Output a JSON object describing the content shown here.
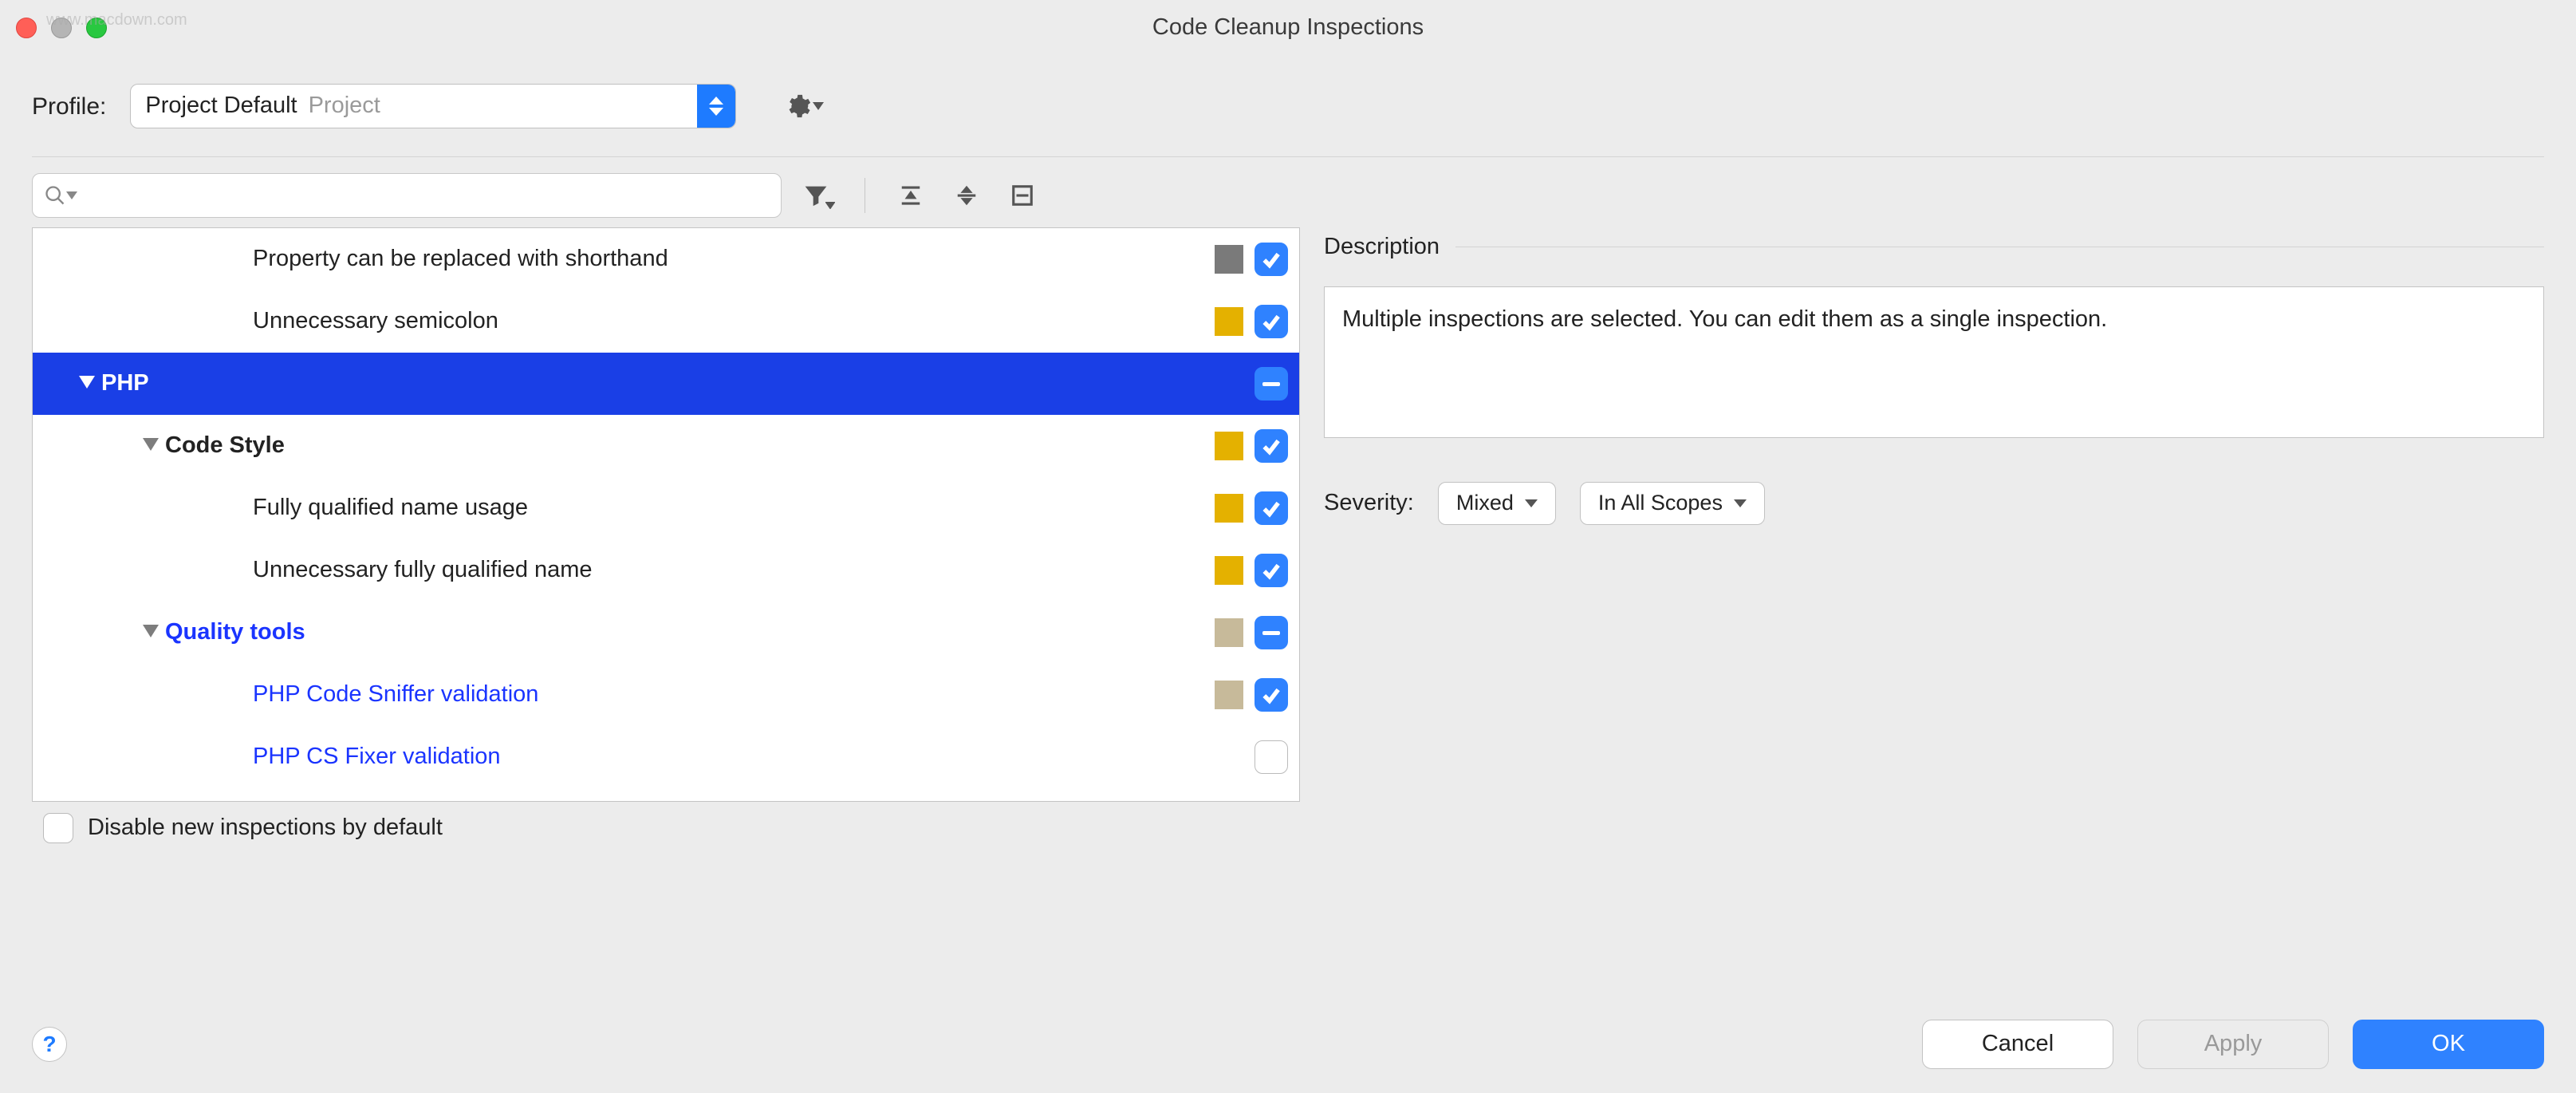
{
  "title": "Code Cleanup Inspections",
  "watermark": "www.macdown.com",
  "profile": {
    "label": "Profile:",
    "value": "Project Default",
    "hint": "Project"
  },
  "search": {
    "placeholder": ""
  },
  "tree": {
    "items": [
      {
        "label": "Property can be replaced with shorthand",
        "indent": 230,
        "bold": false,
        "blue": false,
        "arrow": false,
        "swatch": "gray",
        "check": "on",
        "selected": false
      },
      {
        "label": "Unnecessary semicolon",
        "indent": 230,
        "bold": false,
        "blue": false,
        "arrow": false,
        "swatch": "yellow",
        "check": "on",
        "selected": false
      },
      {
        "label": "PHP",
        "indent": 40,
        "bold": true,
        "blue": false,
        "arrow": true,
        "swatch": "none",
        "check": "mixed",
        "selected": true
      },
      {
        "label": "Code Style",
        "indent": 120,
        "bold": true,
        "blue": false,
        "arrow": true,
        "swatch": "yellow",
        "check": "on",
        "selected": false
      },
      {
        "label": "Fully qualified name usage",
        "indent": 230,
        "bold": false,
        "blue": false,
        "arrow": false,
        "swatch": "yellow",
        "check": "on",
        "selected": false
      },
      {
        "label": "Unnecessary fully qualified name",
        "indent": 230,
        "bold": false,
        "blue": false,
        "arrow": false,
        "swatch": "yellow",
        "check": "on",
        "selected": false
      },
      {
        "label": "Quality tools",
        "indent": 120,
        "bold": true,
        "blue": true,
        "arrow": true,
        "swatch": "beige",
        "check": "mixed",
        "selected": false
      },
      {
        "label": "PHP Code Sniffer validation",
        "indent": 230,
        "bold": false,
        "blue": true,
        "arrow": false,
        "swatch": "beige",
        "check": "on",
        "selected": false
      },
      {
        "label": "PHP CS Fixer validation",
        "indent": 230,
        "bold": false,
        "blue": true,
        "arrow": false,
        "swatch": "none",
        "check": "off",
        "selected": false
      }
    ]
  },
  "disable_new_label": "Disable new inspections by default",
  "description": {
    "header": "Description",
    "text": "Multiple inspections are selected. You can edit them as a single inspection."
  },
  "severity": {
    "label": "Severity:",
    "value": "Mixed",
    "scope": "In All Scopes"
  },
  "buttons": {
    "help": "?",
    "cancel": "Cancel",
    "apply": "Apply",
    "ok": "OK"
  }
}
